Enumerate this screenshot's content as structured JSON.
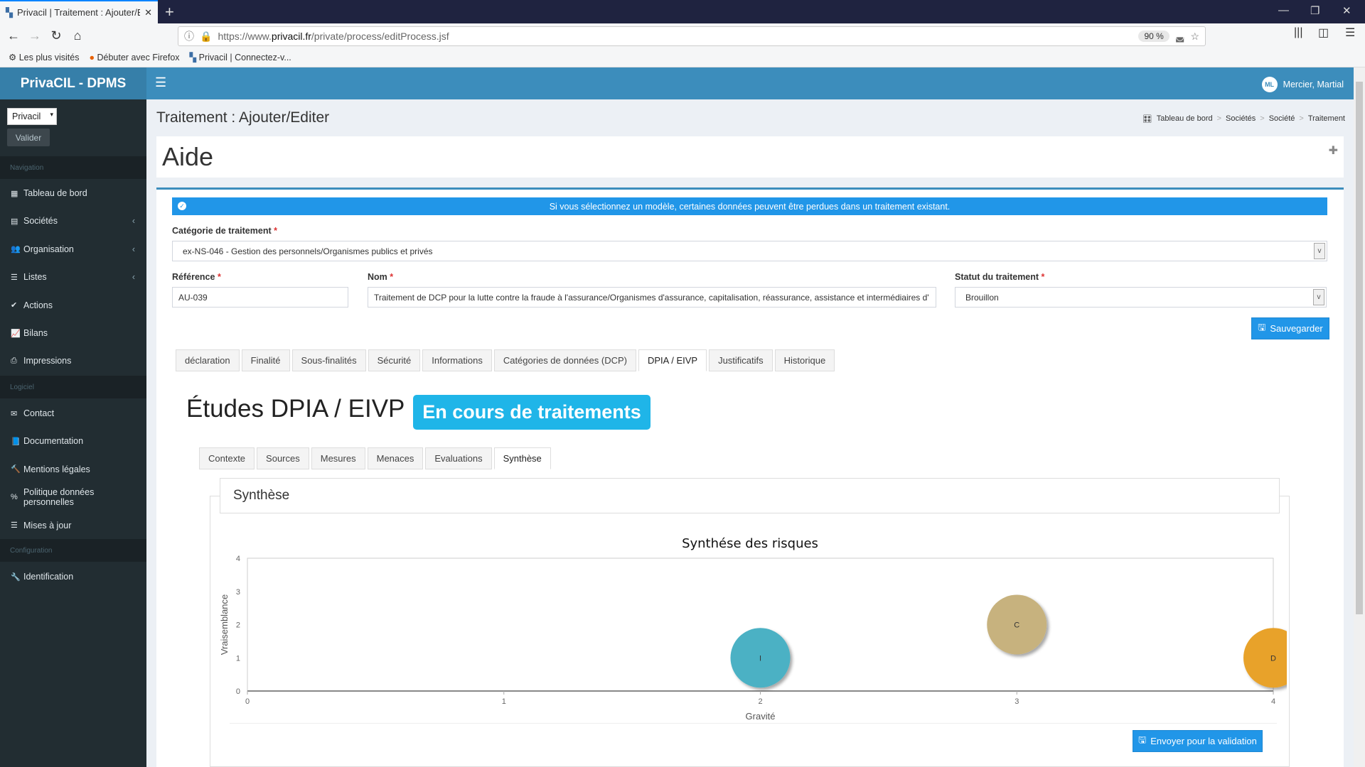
{
  "browser": {
    "tab_title": "Privacil | Traitement : Ajouter/E",
    "url_prefix": "https://www.",
    "url_domain": "privacil.fr",
    "url_path": "/private/process/editProcess.jsf",
    "zoom": "90 %",
    "bookmarks": [
      "Les plus visités",
      "Débuter avec Firefox",
      "Privacil | Connectez-v..."
    ]
  },
  "app": {
    "brand": "PrivaCIL - DPMS",
    "user": "Mercier, Martial",
    "avatar": "ML"
  },
  "sidebar": {
    "org": "Privacil",
    "validate": "Valider",
    "sections": [
      {
        "title": "Navigation"
      },
      {
        "title": "Logiciel"
      },
      {
        "title": "Configuration"
      }
    ],
    "nav": [
      {
        "label": "Tableau de bord",
        "icon": "▦"
      },
      {
        "label": "Sociétés",
        "icon": "▤"
      },
      {
        "label": "Organisation",
        "icon": "👥"
      },
      {
        "label": "Listes",
        "icon": "☰"
      },
      {
        "label": "Actions",
        "icon": "✔"
      },
      {
        "label": "Bilans",
        "icon": "📈"
      },
      {
        "label": "Impressions",
        "icon": "⎙"
      }
    ],
    "logiciel": [
      {
        "label": "Contact",
        "icon": "✉"
      },
      {
        "label": "Documentation",
        "icon": "📘"
      },
      {
        "label": "Mentions légales",
        "icon": "🔨"
      },
      {
        "label": "Politique données personnelles",
        "icon": "%"
      },
      {
        "label": "Mises à jour",
        "icon": "☰"
      }
    ],
    "config": [
      {
        "label": "Identification",
        "icon": "🔧"
      }
    ]
  },
  "page": {
    "title": "Traitement : Ajouter/Editer",
    "breadcrumb": [
      "Tableau de bord",
      "Sociétés",
      "Société",
      "Traitement"
    ],
    "help": "Aide"
  },
  "form": {
    "alert": "Si vous sélectionnez un modèle, certaines données peuvent être perdues dans un traitement existant.",
    "category_label": "Catégorie de traitement",
    "category_value": "ex-NS-046 - Gestion des personnels/Organismes publics et privés",
    "ref_label": "Référence",
    "ref_value": "AU-039",
    "name_label": "Nom",
    "name_value": "Traitement de DCP pour la lutte contre la fraude à l'assurance/Organismes d'assurance, capitalisation, réassurance, assistance et intermédiaires d'",
    "status_label": "Statut du traitement",
    "status_value": "Brouillon",
    "save": "Sauvegarder",
    "required": "*"
  },
  "tabs": [
    "déclaration",
    "Finalité",
    "Sous-finalités",
    "Sécurité",
    "Informations",
    "Catégories de données (DCP)",
    "DPIA / EIVP",
    "Justificatifs",
    "Historique"
  ],
  "dpia": {
    "heading": "Études DPIA / EIVP :",
    "badge": "En cours de traitements",
    "subtabs": [
      "Contexte",
      "Sources",
      "Mesures",
      "Menaces",
      "Evaluations",
      "Synthèse"
    ],
    "panel_title": "Synthèse",
    "send": "Envoyer pour la validation"
  },
  "chart_data": {
    "type": "scatter",
    "title": "Synthése des risques",
    "xlabel": "Gravité",
    "ylabel": "Vraisemblance",
    "xlim": [
      0,
      4
    ],
    "ylim": [
      0,
      4
    ],
    "xticks": [
      "0",
      "1",
      "2",
      "3",
      "4"
    ],
    "yticks": [
      "0",
      "1",
      "2",
      "3",
      "4"
    ],
    "points": [
      {
        "label": "I",
        "x": 2,
        "y": 1,
        "color": "#4bb1c4"
      },
      {
        "label": "C",
        "x": 3,
        "y": 2,
        "color": "#c7b27e"
      },
      {
        "label": "D",
        "x": 4,
        "y": 1,
        "color": "#e8a22c"
      }
    ]
  }
}
